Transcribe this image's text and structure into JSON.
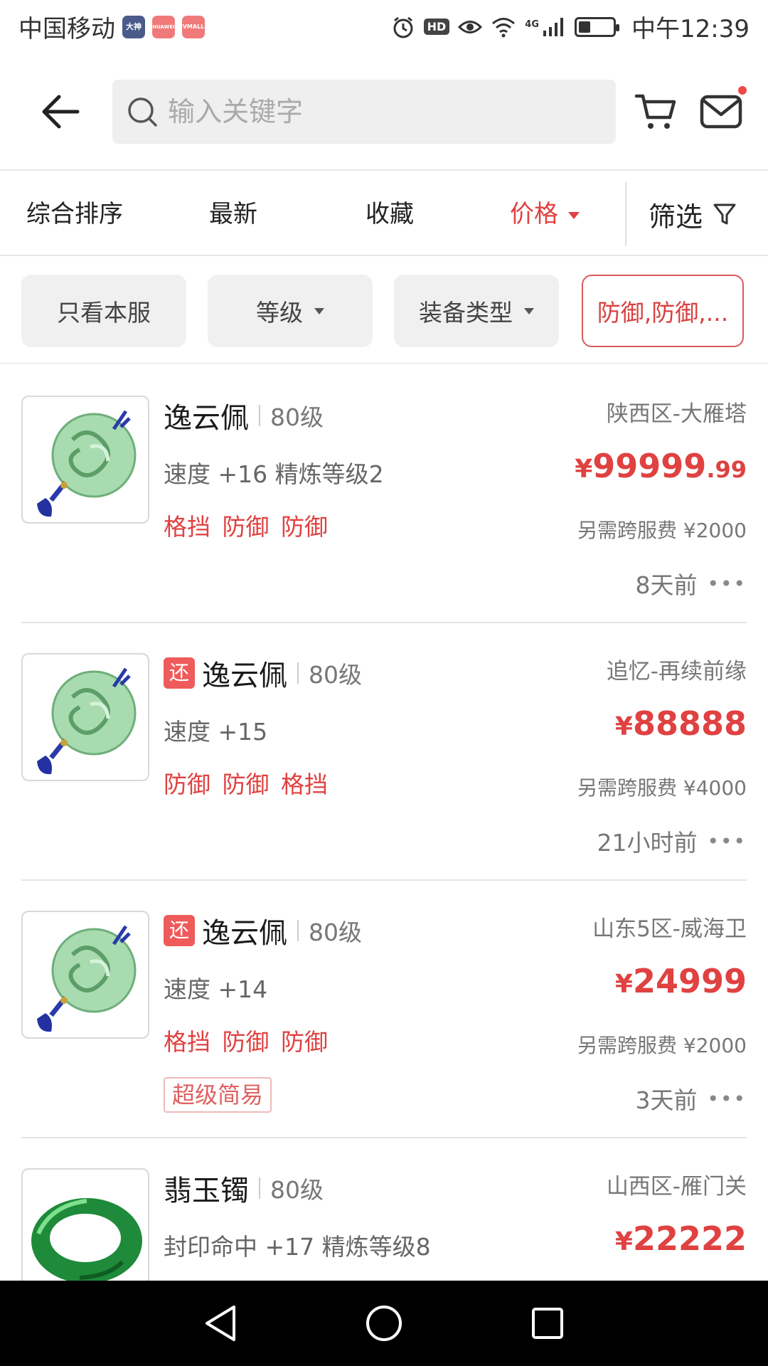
{
  "status_bar": {
    "carrier": "中国移动",
    "app_icons": [
      "大神",
      "HUAWEI",
      "VMALL"
    ],
    "hd": "HD",
    "network": "4G",
    "battery_level": 0.3,
    "time": "中午12:39"
  },
  "header": {
    "search_placeholder": "输入关键字",
    "icons": [
      "back-arrow-icon",
      "search-icon",
      "cart-icon",
      "mail-icon"
    ]
  },
  "sort_bar": {
    "items": [
      "综合排序",
      "最新",
      "收藏",
      "价格"
    ],
    "active": "价格",
    "filter_label": "筛选"
  },
  "chips": {
    "only_this_server": "只看本服",
    "level": "等级",
    "equip_type": "装备类型",
    "selected_filter": "防御,防御,..."
  },
  "items": [
    {
      "name": "逸云佩",
      "level": "80级",
      "stats": "速度 +16 精炼等级2",
      "tags": "格挡 防御 防御",
      "server": "陕西区-大雁塔",
      "price_symbol": "¥",
      "price_int": "99999",
      "price_dec": ".99",
      "fee": "另需跨服费 ¥2000",
      "time": "8天前"
    },
    {
      "badge": "还",
      "name": "逸云佩",
      "level": "80级",
      "stats": "速度 +15",
      "tags": "防御 防御 格挡",
      "server": "追忆-再续前缘",
      "price_symbol": "¥",
      "price_int": "88888",
      "fee": "另需跨服费 ¥4000",
      "time": "21小时前"
    },
    {
      "badge": "还",
      "name": "逸云佩",
      "level": "80级",
      "stats": "速度 +14",
      "tags": "格挡 防御 防御",
      "extra_tag": "超级简易",
      "server": "山东5区-威海卫",
      "price_symbol": "¥",
      "price_int": "24999",
      "fee": "另需跨服费 ¥2000",
      "time": "3天前"
    },
    {
      "name": "翡玉镯",
      "level": "80级",
      "stats": "封印命中 +17 精炼等级8",
      "server": "山西区-雁门关",
      "price_symbol": "¥",
      "price_int": "22222"
    }
  ],
  "colors": {
    "accent": "#e04141",
    "badge": "#ef5b5b",
    "nav_bg": "#000000"
  }
}
